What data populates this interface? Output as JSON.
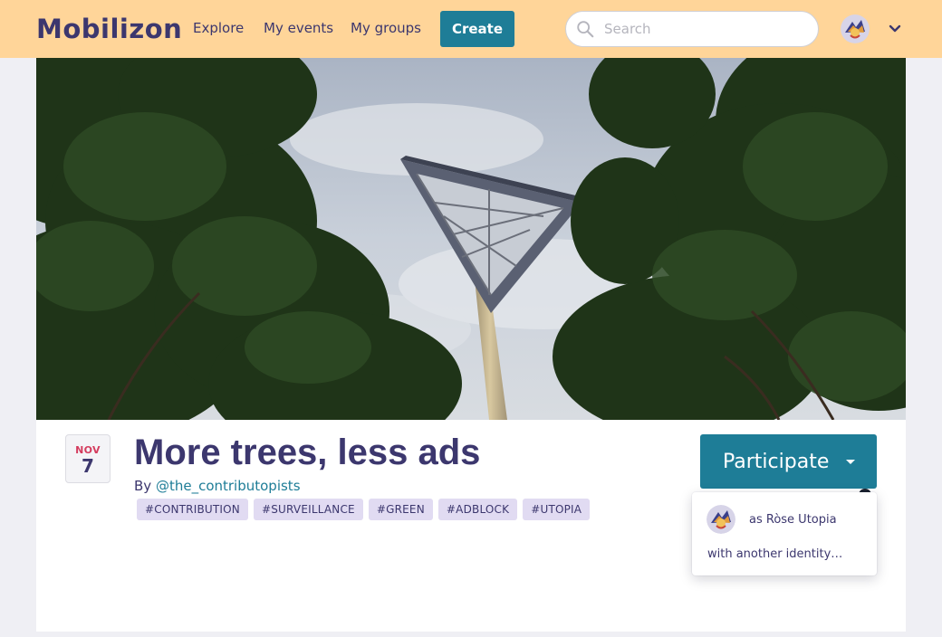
{
  "app": {
    "logo_text": "Mobilizon"
  },
  "nav": {
    "explore": "Explore",
    "my_events": "My events",
    "my_groups": "My groups",
    "create": "Create",
    "search_placeholder": "Search"
  },
  "event": {
    "date_month": "NOV",
    "date_day": "7",
    "title": "More trees, less ads",
    "by_prefix": "By",
    "organizer": "@the_contributopists",
    "tags": [
      "#CONTRIBUTION",
      "#SURVEILLANCE",
      "#GREEN",
      "#ADBLOCK",
      "#UTOPIA"
    ]
  },
  "participate": {
    "button_label": "Participate",
    "options": {
      "as_identity": "as Ròse Utopia",
      "other_identity": "with another identity…"
    }
  },
  "colors": {
    "navbar_bg": "#ffd599",
    "primary": "#1e7d97",
    "text": "#3c376e",
    "tag_bg": "#e1dbf2",
    "date_month": "#d43c5e"
  },
  "icons": {
    "search": "search-icon",
    "chevron": "chevron-down-icon",
    "avatar": "avatar-rose-utopia",
    "caret": "caret-down-icon"
  }
}
